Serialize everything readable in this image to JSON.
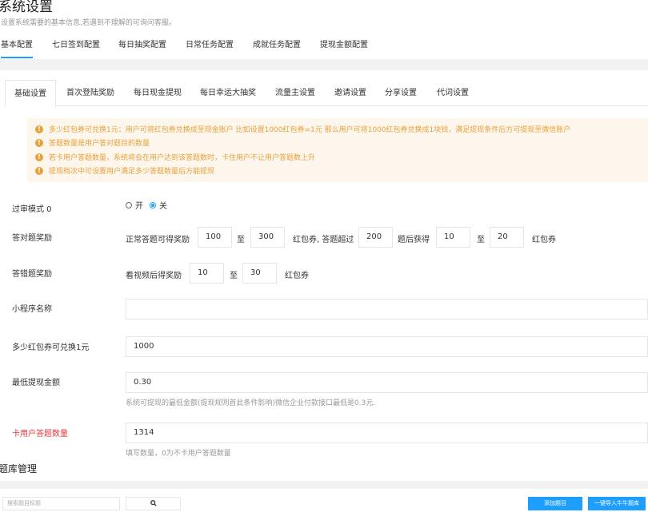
{
  "header": {
    "title": "系统设置",
    "subtitle": "设置系统需要的基本信息,若遇到不理解的可询问客服。"
  },
  "main_tabs": [
    {
      "label": "基本配置",
      "active": true
    },
    {
      "label": "七日签到配置",
      "active": false
    },
    {
      "label": "每日抽奖配置",
      "active": false
    },
    {
      "label": "日常任务配置",
      "active": false
    },
    {
      "label": "成就任务配置",
      "active": false
    },
    {
      "label": "提现金额配置",
      "active": false
    }
  ],
  "sub_tabs": [
    {
      "label": "基础设置",
      "active": true
    },
    {
      "label": "首次登陆奖励",
      "active": false
    },
    {
      "label": "每日现金提现",
      "active": false
    },
    {
      "label": "每日幸运大抽奖",
      "active": false
    },
    {
      "label": "流量主设置",
      "active": false
    },
    {
      "label": "邀请设置",
      "active": false
    },
    {
      "label": "分享设置",
      "active": false
    },
    {
      "label": "代词设置",
      "active": false
    }
  ],
  "notices": [
    "多少红包券可兑换1元：用户可将红包券兑换成至现金账户 比如设置1000红包券=1元 那么用户可将1000红包券兑换成1块钱，满足提现条件后方可提现至微信账户",
    "答题数量是用户答对题目的数量",
    "若卡用户答题数量，系统将会在用户达到该答题数时，卡住用户不让用户答题数上升",
    "提现档次中可设置用户满足多少答题数量后方能提现"
  ],
  "form": {
    "review_mode": {
      "label": "过审模式 0",
      "options": [
        "开",
        "关"
      ],
      "selected": "关"
    },
    "correct_reward": {
      "label": "答对题奖励",
      "prefix": "正常答题可得奖励",
      "min": "100",
      "to1": "至",
      "max": "300",
      "mid": "红包券, 答题超过",
      "threshold": "200",
      "after": "题后获得",
      "min2": "10",
      "to2": "至",
      "max2": "20",
      "unit": "红包券"
    },
    "wrong_reward": {
      "label": "答错题奖励",
      "prefix": "看视频后得奖励",
      "min": "10",
      "to": "至",
      "max": "30",
      "unit": "红包券"
    },
    "mini_program_name": {
      "label": "小程序名称",
      "value": ""
    },
    "exchange_rate": {
      "label": "多少红包券可兑换1元",
      "value": "1000"
    },
    "min_withdraw": {
      "label": "最低提现金额",
      "value": "0.30",
      "help": "系统可提现的最低金额(提现规则首此条件影响)微信企业付款接口最低是0.3元."
    },
    "limit_answers": {
      "label": "卡用户答题数量",
      "value": "1314",
      "help": "填写数量，0为不卡用户答题数量"
    }
  },
  "question_bank": {
    "title": "题库管理",
    "search_placeholder": "搜索题目标题",
    "search_icon": "search-icon",
    "add_button": "添加题目",
    "import_button": "一键导入牛牛题库"
  },
  "colors": {
    "accent": "#1e9fff",
    "warning": "#e6a23c",
    "warning_bg": "#fdf6ec",
    "danger": "#e4393c"
  }
}
